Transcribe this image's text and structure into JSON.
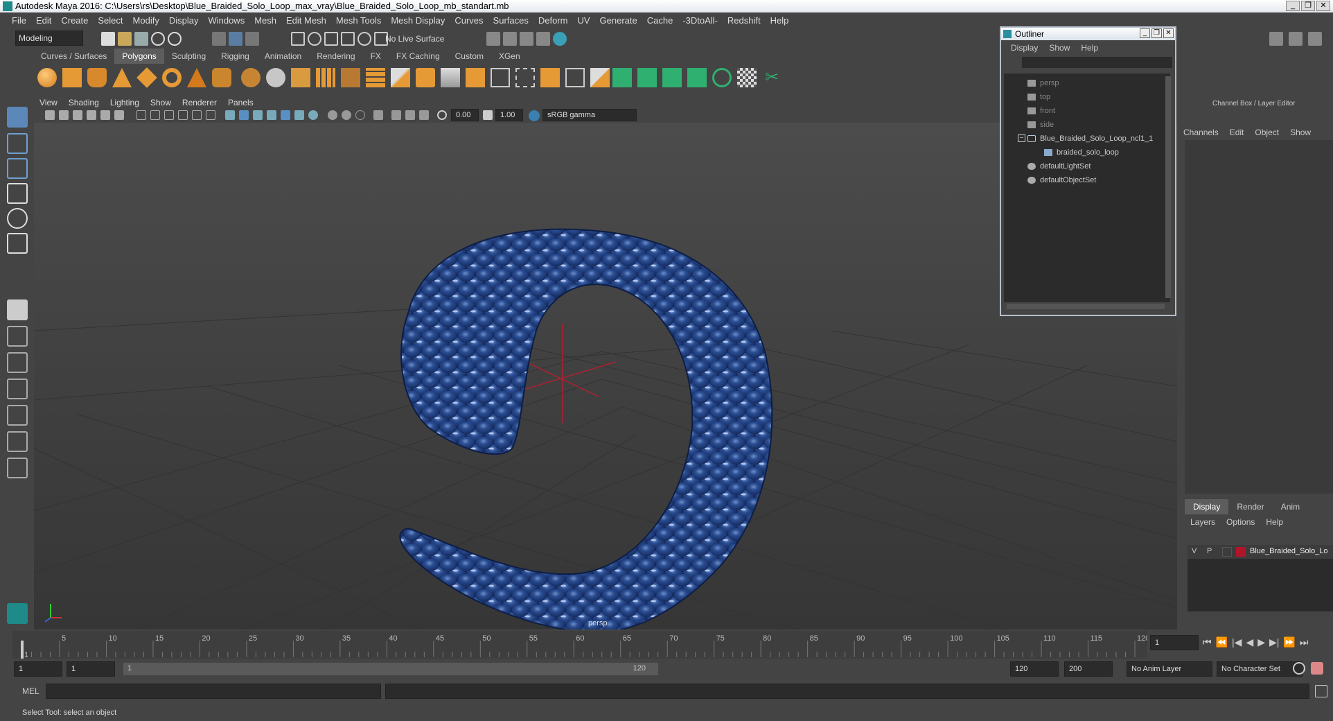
{
  "window": {
    "title": "Autodesk Maya 2016: C:\\Users\\rs\\Desktop\\Blue_Braided_Solo_Loop_max_vray\\Blue_Braided_Solo_Loop_mb_standart.mb",
    "controls": [
      "_",
      "❐",
      "✕"
    ]
  },
  "menubar": [
    "File",
    "Edit",
    "Create",
    "Select",
    "Modify",
    "Display",
    "Windows",
    "Mesh",
    "Edit Mesh",
    "Mesh Tools",
    "Mesh Display",
    "Curves",
    "Surfaces",
    "Deform",
    "UV",
    "Generate",
    "Cache",
    "-3DtoAll-",
    "Redshift",
    "Help"
  ],
  "toolbar": {
    "mode": "Modeling",
    "live_surface": "No Live Surface"
  },
  "shelf_tabs": [
    "Curves / Surfaces",
    "Polygons",
    "Sculpting",
    "Rigging",
    "Animation",
    "Rendering",
    "FX",
    "FX Caching",
    "Custom",
    "XGen"
  ],
  "shelf_active": "Polygons",
  "viewport": {
    "menu": [
      "View",
      "Shading",
      "Lighting",
      "Show",
      "Renderer",
      "Panels"
    ],
    "exposure": "0.00",
    "gamma": "1.00",
    "color_space": "sRGB gamma",
    "camera_label": "persp",
    "braid_color": "#1f3f7e"
  },
  "outliner": {
    "title": "Outliner",
    "menu": [
      "Display",
      "Show",
      "Help"
    ],
    "items": [
      {
        "label": "persp",
        "icon": "camera-icon"
      },
      {
        "label": "top",
        "icon": "camera-icon"
      },
      {
        "label": "front",
        "icon": "camera-icon"
      },
      {
        "label": "side",
        "icon": "camera-icon"
      },
      {
        "label": "Blue_Braided_Solo_Loop_ncl1_1",
        "icon": "group-icon"
      },
      {
        "label": "braided_solo_loop",
        "icon": "mesh-icon"
      },
      {
        "label": "defaultLightSet",
        "icon": "set-icon"
      },
      {
        "label": "defaultObjectSet",
        "icon": "set-icon"
      }
    ]
  },
  "channelbox": {
    "title": "Channel Box / Layer Editor",
    "menu": [
      "Channels",
      "Edit",
      "Object",
      "Show"
    ],
    "layer_tabs": [
      "Display",
      "Render",
      "Anim"
    ],
    "layer_menu": [
      "Layers",
      "Options",
      "Help"
    ],
    "layer": {
      "v": "V",
      "p": "P",
      "name": "Blue_Braided_Solo_Lo",
      "color": "#b0142a"
    }
  },
  "timeline": {
    "ticks": [
      "1",
      "5",
      "10",
      "15",
      "20",
      "25",
      "30",
      "35",
      "40",
      "45",
      "50",
      "55",
      "60",
      "65",
      "70",
      "75",
      "80",
      "85",
      "90",
      "95",
      "100",
      "105",
      "110",
      "115",
      "120"
    ],
    "current_frame": "1"
  },
  "range": {
    "start": "1",
    "start2": "1",
    "slider_start": "1",
    "slider_end": "120",
    "end": "120",
    "end2": "200",
    "anim_layer": "No Anim Layer",
    "char_set": "No Character Set"
  },
  "cmd": {
    "label": "MEL"
  },
  "help_text": "Select Tool: select an object"
}
